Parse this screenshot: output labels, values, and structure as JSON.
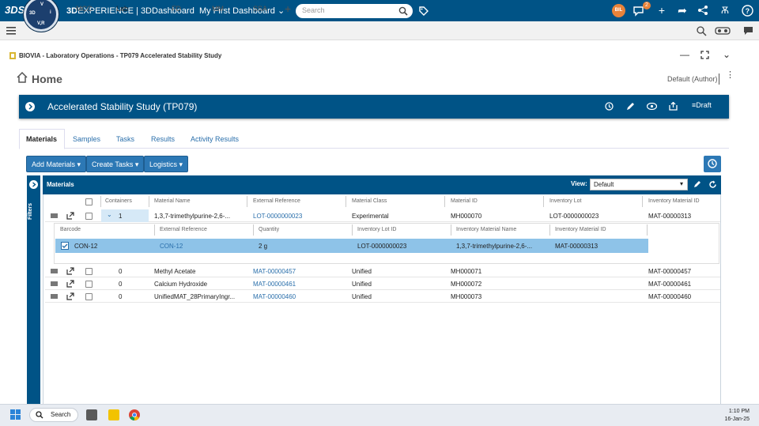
{
  "topbar": {
    "brand_bold": "3D",
    "brand_rest": "EXPERIENCE | 3DDashboard",
    "dashboard": "My First Dashboard",
    "search_placeholder": "Search",
    "compass_top": "3D",
    "compass_v": "V",
    "compass_vr": "V,R",
    "compass_i": "i",
    "avatar_initials": "BIL",
    "notification_count": "2",
    "ds_logo": "3DS"
  },
  "dashboard_tabs": [
    "MCC",
    "Lab",
    "FD",
    "MM",
    "SSA"
  ],
  "app": {
    "title": "BIOVIA - Laboratory Operations - TP079 Accelerated Stability Study",
    "home": "Home",
    "role": "Default (Author)",
    "study_title": "Accelerated Stability Study (TP079)",
    "status": "Draft"
  },
  "subtabs": [
    "Materials",
    "Samples",
    "Tasks",
    "Results",
    "Activity Results"
  ],
  "buttons": {
    "add_materials": "Add Materials",
    "create_tasks": "Create Tasks",
    "logistics": "Logistics"
  },
  "grid": {
    "title": "Materials",
    "view_label": "View:",
    "view_value": "Default",
    "filters_label": "Filters",
    "columns": [
      "Containers",
      "Material Name",
      "External Reference",
      "Material Class",
      "Material ID",
      "Inventory Lot",
      "Inventory Material ID"
    ],
    "rows": [
      {
        "containers": "1",
        "name": "1,3,7-trimethylpurine-2,6-...",
        "ref": "LOT-0000000023",
        "class": "Experimental",
        "id": "MH000070",
        "lot": "LOT-0000000023",
        "inv_id": "MAT-00000313"
      },
      {
        "containers": "0",
        "name": "Methyl Acetate",
        "ref": "MAT-00000457",
        "class": "Unified",
        "id": "MH000071",
        "lot": "",
        "inv_id": "MAT-00000457"
      },
      {
        "containers": "0",
        "name": "Calcium Hydroxide",
        "ref": "MAT-00000461",
        "class": "Unified",
        "id": "MH000072",
        "lot": "",
        "inv_id": "MAT-00000461"
      },
      {
        "containers": "0",
        "name": "UnifiedMAT_28PrimaryIngr...",
        "ref": "MAT-00000460",
        "class": "Unified",
        "id": "MH000073",
        "lot": "",
        "inv_id": "MAT-00000460"
      }
    ],
    "subcolumns": [
      "Barcode",
      "External Reference",
      "Quantity",
      "Inventory Lot ID",
      "Inventory Material Name",
      "Inventory Material ID"
    ],
    "subrow": {
      "barcode": "CON-12",
      "ref": "CON-12",
      "quantity": "2 g",
      "lot_id": "LOT-0000000023",
      "mat_name": "1,3,7-trimethylpurine-2,6-...",
      "mat_id": "MAT-00000313"
    }
  },
  "taskbar": {
    "search": "Search",
    "time": "1:10 PM",
    "date": "16-Jan-25"
  }
}
